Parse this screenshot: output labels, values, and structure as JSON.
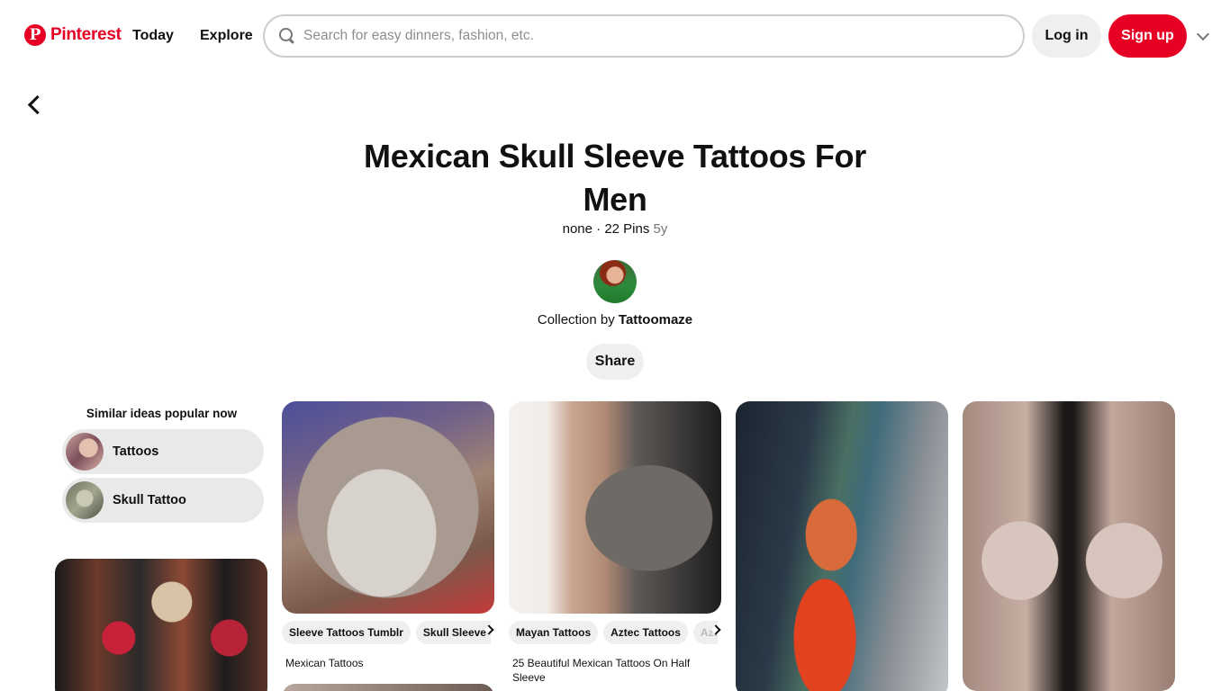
{
  "header": {
    "logo_mark": "P",
    "logo_text": "Pinterest",
    "nav_today": "Today",
    "nav_explore": "Explore",
    "search_placeholder": "Search for easy dinners, fashion, etc.",
    "search_value": "",
    "login_label": "Log in",
    "signup_label": "Sign up",
    "brand_color": "#e60023"
  },
  "board": {
    "title": "Mexican Skull Sleeve Tattoos For Men",
    "meta_prefix": "none · 22 Pins ",
    "meta_age": "5y",
    "collection_prefix": "Collection by ",
    "owner": "Tattoomaze",
    "share_label": "Share"
  },
  "similar": {
    "heading": "Similar ideas popular now",
    "items": [
      {
        "label": "Tattoos"
      },
      {
        "label": "Skull Tattoo"
      }
    ]
  },
  "pins": [
    {
      "chips": [
        "Sleeve Tattoos Tumblr",
        "Skull Sleeve Tattoos"
      ],
      "caption": "Mexican Tattoos"
    },
    {
      "chips": [
        "Mayan Tattoos",
        "Aztec Tattoos",
        "Aztec"
      ],
      "caption": "25 Beautiful Mexican Tattoos On Half Sleeve"
    }
  ],
  "icons": {
    "logo": "pinterest-logo-icon",
    "search": "search-icon",
    "more": "chevron-down-icon",
    "back": "chevron-left-icon",
    "chip_scroll": "chevron-right-icon"
  }
}
